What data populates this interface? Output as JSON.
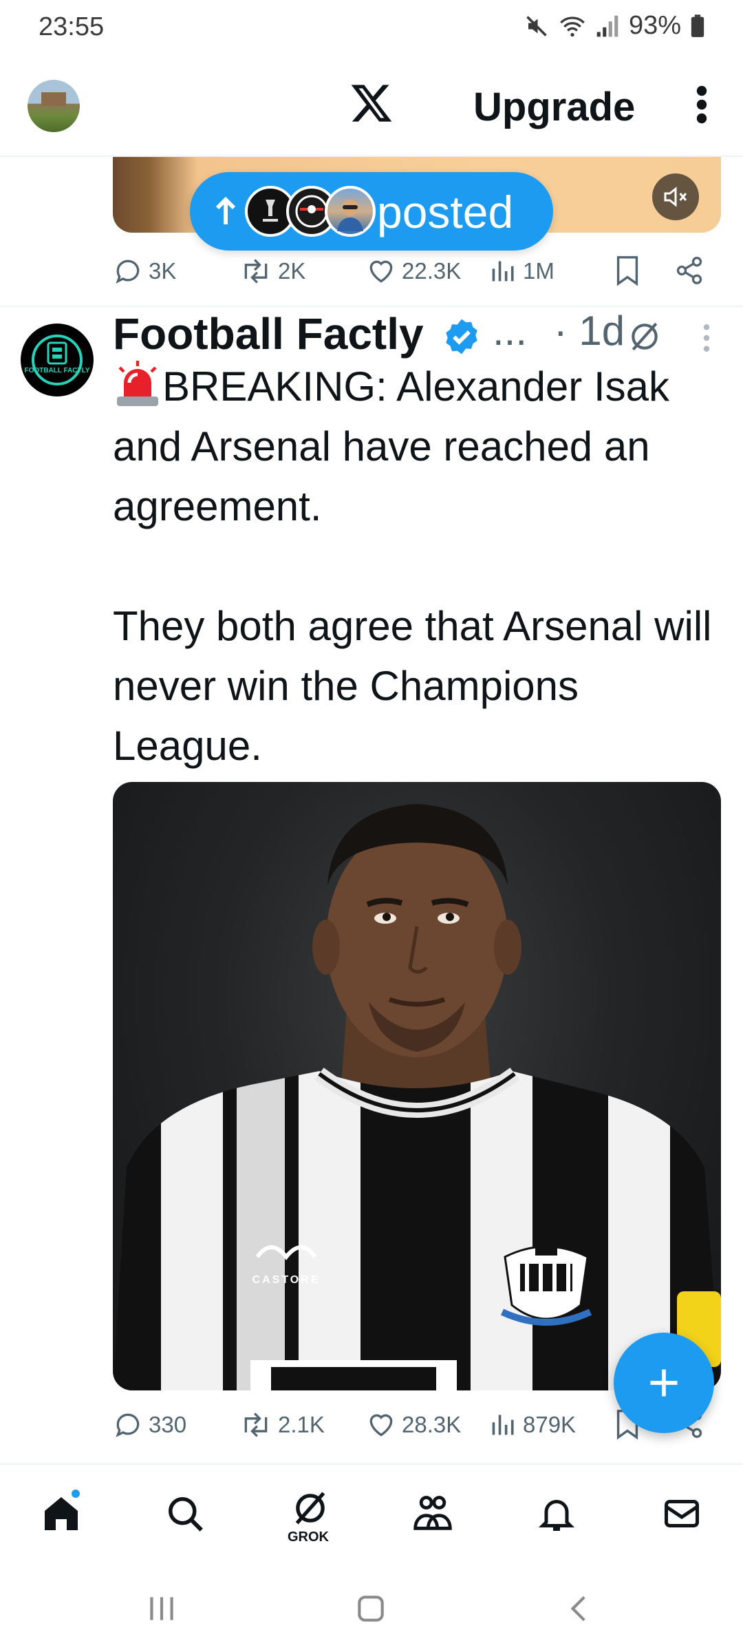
{
  "status_bar": {
    "time": "23:55",
    "battery": "93%"
  },
  "top_bar": {
    "upgrade_label": "Upgrade"
  },
  "posted_pill": {
    "label": "posted"
  },
  "prev_tweet": {
    "replies": "3K",
    "reposts": "2K",
    "likes": "22.3K",
    "views": "1M"
  },
  "tweet": {
    "author": "Football Factly",
    "ellipsis": "...",
    "time": "· 1d",
    "avatar_text": "FOOTBALL FACTLY",
    "text": "BREAKING: Alexander Isak and Arsenal have reached an agreement.\n\nThey both agree that Arsenal will never win the Champions League.",
    "replies": "330",
    "reposts": "2.1K",
    "likes": "28.3K",
    "views": "879K",
    "image_jersey_text": "CASTORE"
  },
  "bottom_nav": {
    "grok_label": "GROK"
  },
  "colors": {
    "accent": "#1d9bf0",
    "text": "#0f1419",
    "muted": "#536471",
    "divider": "#eff3f4"
  }
}
